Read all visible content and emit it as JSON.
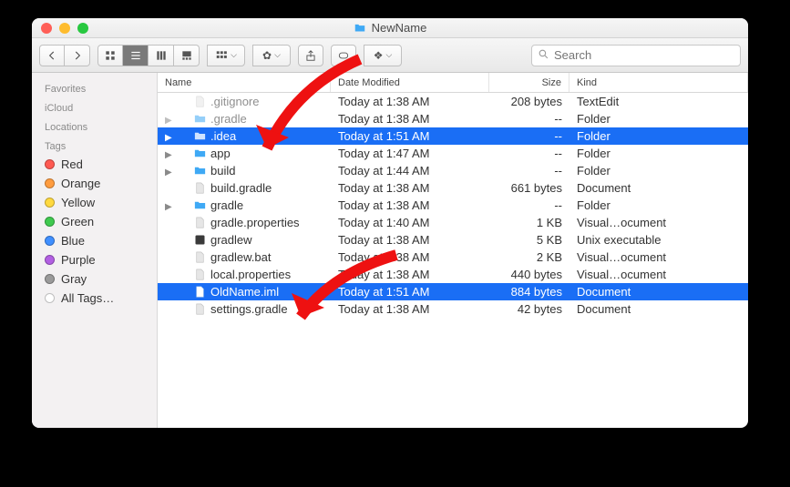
{
  "window": {
    "title": "NewName"
  },
  "toolbar": {
    "search_placeholder": "Search"
  },
  "sidebar": {
    "sections": [
      {
        "label": "Favorites"
      },
      {
        "label": "iCloud"
      },
      {
        "label": "Locations"
      },
      {
        "label": "Tags"
      }
    ],
    "tags": [
      {
        "label": "Red",
        "color": "#ff5a52"
      },
      {
        "label": "Orange",
        "color": "#ff9c3f"
      },
      {
        "label": "Yellow",
        "color": "#ffd93f"
      },
      {
        "label": "Green",
        "color": "#3fc94f"
      },
      {
        "label": "Blue",
        "color": "#3f8fff"
      },
      {
        "label": "Purple",
        "color": "#b25fe2"
      },
      {
        "label": "Gray",
        "color": "#9a9a9a"
      }
    ],
    "all_tags_label": "All Tags…"
  },
  "columns": {
    "name": "Name",
    "date": "Date Modified",
    "size": "Size",
    "kind": "Kind"
  },
  "rows": [
    {
      "name": ".gitignore",
      "date": "Today at 1:38 AM",
      "size": "208 bytes",
      "kind": "TextEdit",
      "icon": "doc",
      "expandable": false,
      "selected": false,
      "dim": true
    },
    {
      "name": ".gradle",
      "date": "Today at 1:38 AM",
      "size": "--",
      "kind": "Folder",
      "icon": "folder",
      "expandable": true,
      "selected": false,
      "dim": true
    },
    {
      "name": ".idea",
      "date": "Today at 1:51 AM",
      "size": "--",
      "kind": "Folder",
      "icon": "folder",
      "expandable": true,
      "selected": true
    },
    {
      "name": "app",
      "date": "Today at 1:47 AM",
      "size": "--",
      "kind": "Folder",
      "icon": "folder",
      "expandable": true,
      "selected": false
    },
    {
      "name": "build",
      "date": "Today at 1:44 AM",
      "size": "--",
      "kind": "Folder",
      "icon": "folder",
      "expandable": true,
      "selected": false
    },
    {
      "name": "build.gradle",
      "date": "Today at 1:38 AM",
      "size": "661 bytes",
      "kind": "Document",
      "icon": "doc",
      "expandable": false,
      "selected": false
    },
    {
      "name": "gradle",
      "date": "Today at 1:38 AM",
      "size": "--",
      "kind": "Folder",
      "icon": "folder",
      "expandable": true,
      "selected": false
    },
    {
      "name": "gradle.properties",
      "date": "Today at 1:40 AM",
      "size": "1 KB",
      "kind": "Visual…ocument",
      "icon": "doc",
      "expandable": false,
      "selected": false
    },
    {
      "name": "gradlew",
      "date": "Today at 1:38 AM",
      "size": "5 KB",
      "kind": "Unix executable",
      "icon": "exec",
      "expandable": false,
      "selected": false
    },
    {
      "name": "gradlew.bat",
      "date": "Today at 1:38 AM",
      "size": "2 KB",
      "kind": "Visual…ocument",
      "icon": "doc",
      "expandable": false,
      "selected": false
    },
    {
      "name": "local.properties",
      "date": "Today at 1:38 AM",
      "size": "440 bytes",
      "kind": "Visual…ocument",
      "icon": "doc",
      "expandable": false,
      "selected": false
    },
    {
      "name": "OldName.iml",
      "date": "Today at 1:51 AM",
      "size": "884 bytes",
      "kind": "Document",
      "icon": "doc",
      "expandable": false,
      "selected": true
    },
    {
      "name": "settings.gradle",
      "date": "Today at 1:38 AM",
      "size": "42 bytes",
      "kind": "Document",
      "icon": "doc",
      "expandable": false,
      "selected": false
    }
  ],
  "annotations": {
    "arrow_color": "#e11"
  }
}
